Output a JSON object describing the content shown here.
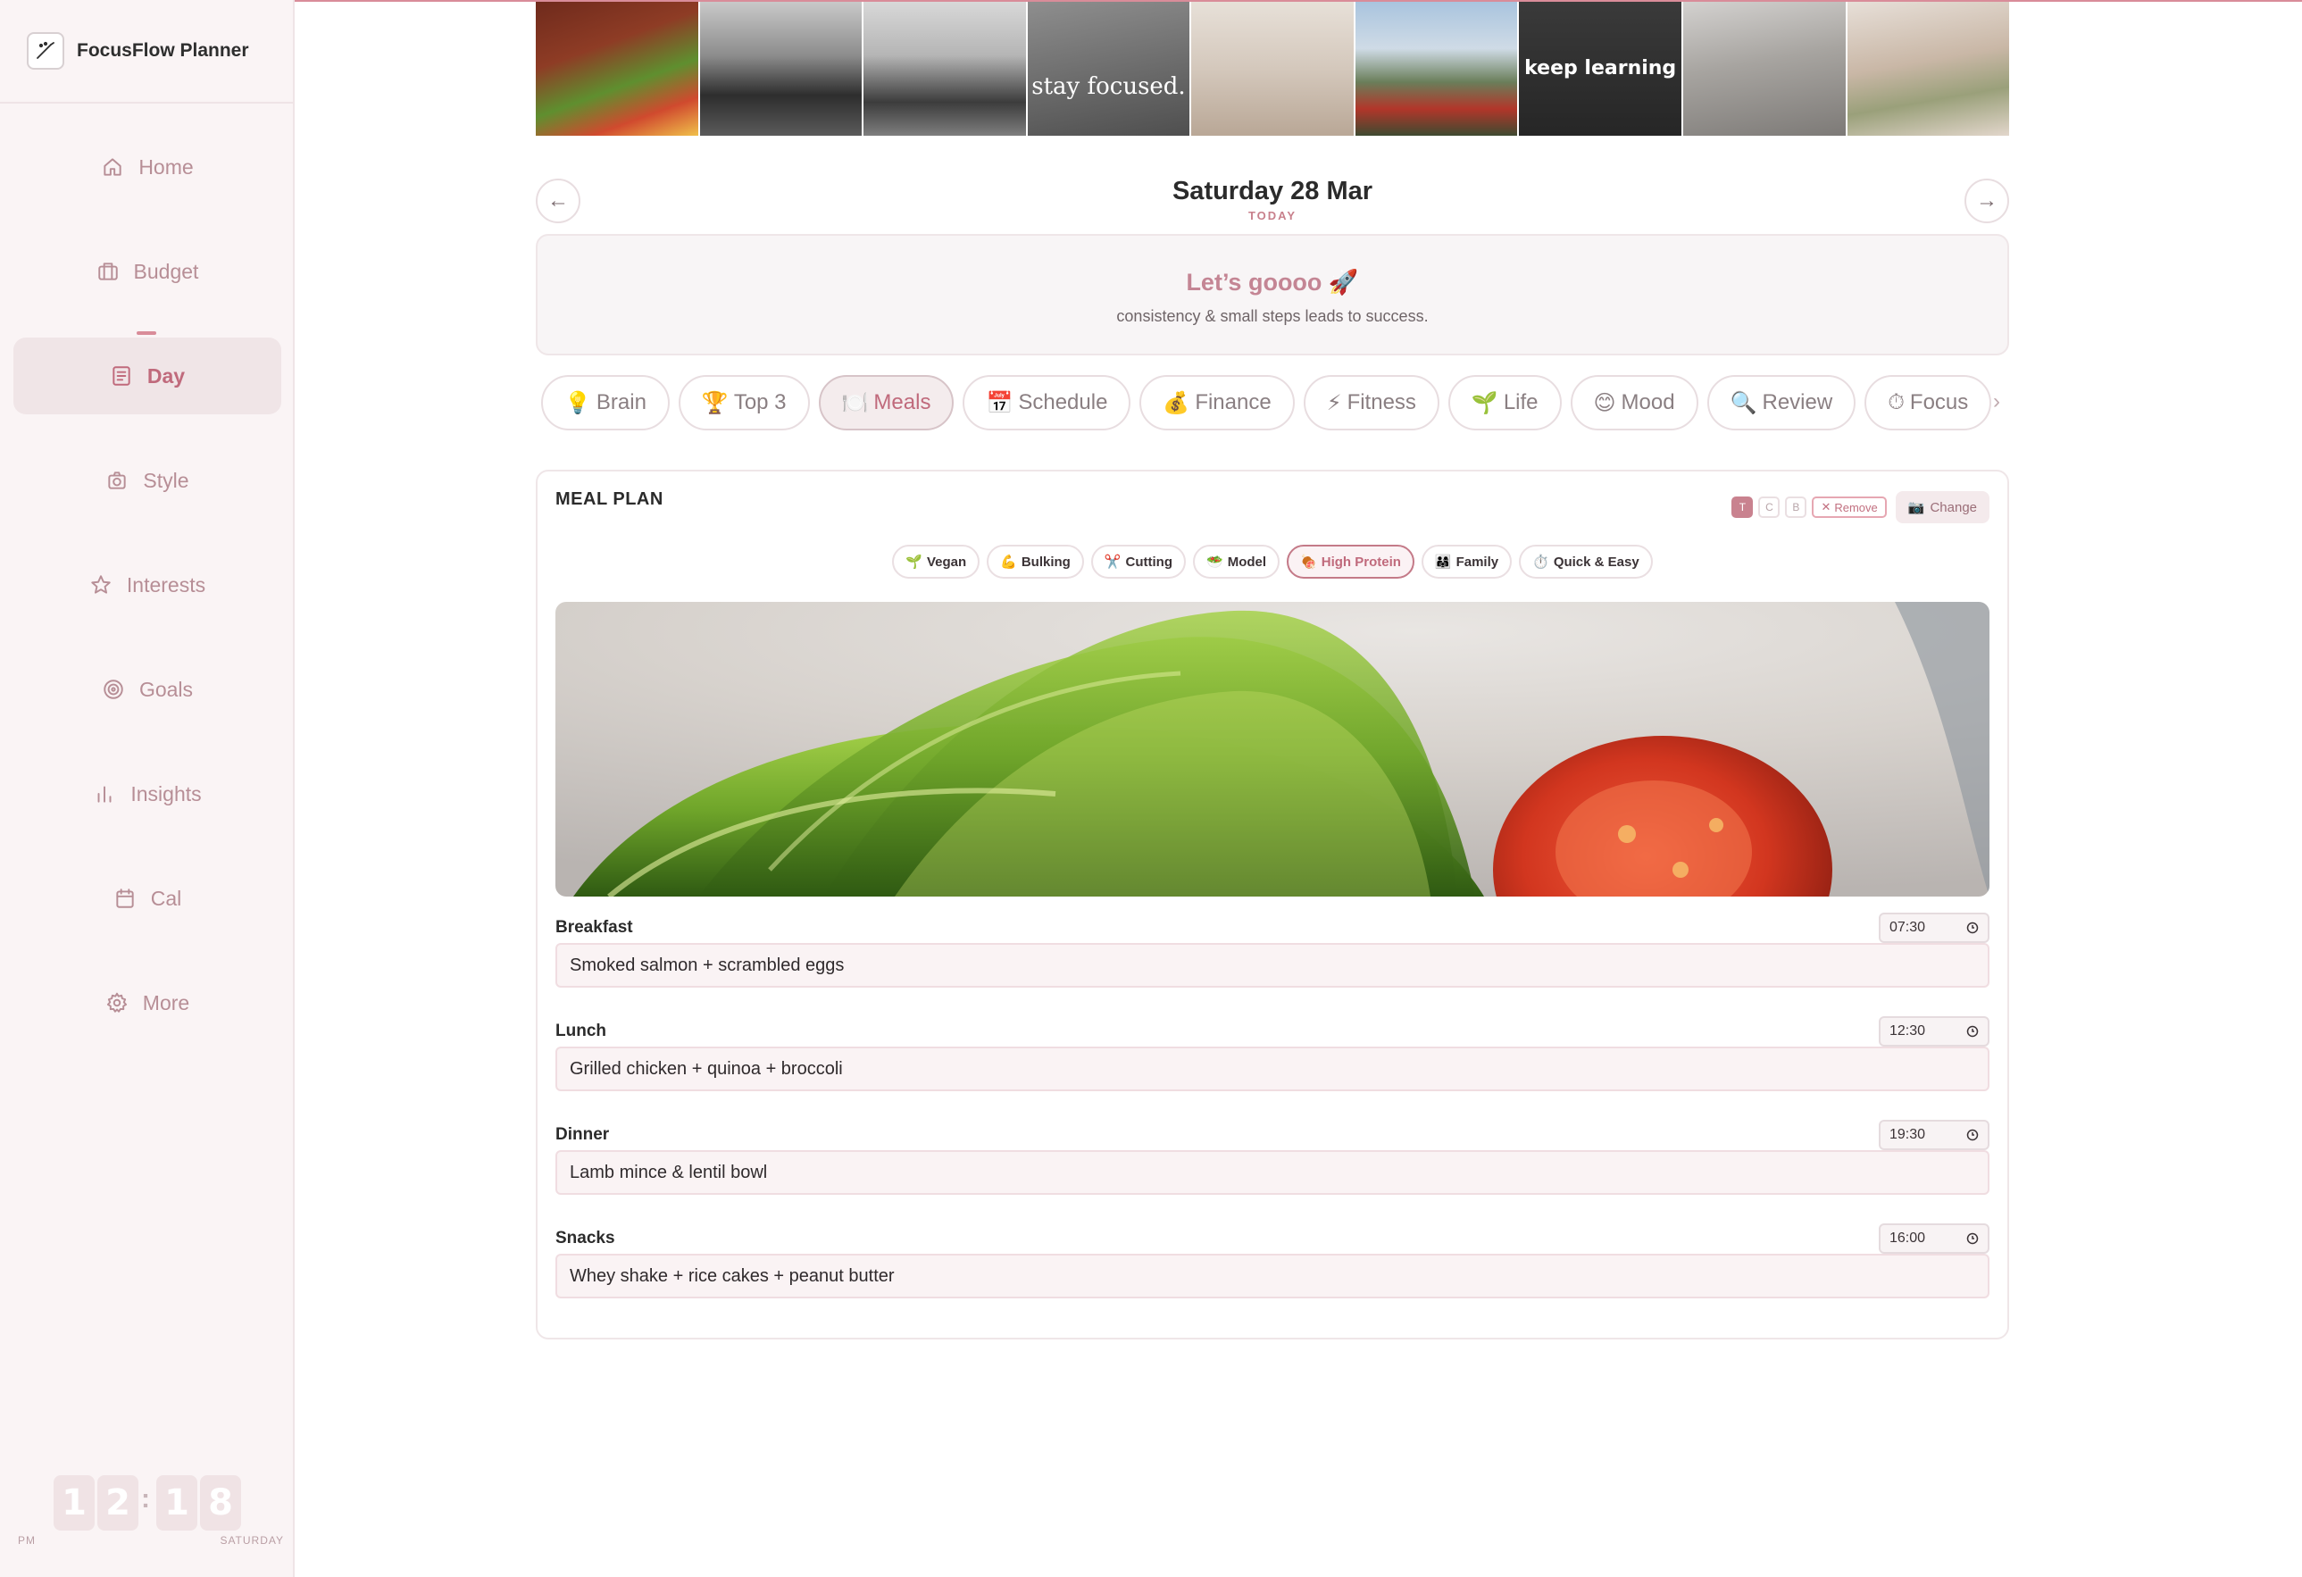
{
  "app": {
    "name": "FocusFlow Planner"
  },
  "nav": {
    "items": [
      {
        "label": "Home",
        "icon": "home-icon"
      },
      {
        "label": "Budget",
        "icon": "briefcase-icon"
      },
      {
        "label": "Day",
        "icon": "day-page-icon",
        "active": true
      },
      {
        "label": "Style",
        "icon": "camera-icon"
      },
      {
        "label": "Interests",
        "icon": "star-icon"
      },
      {
        "label": "Goals",
        "icon": "target-icon"
      },
      {
        "label": "Insights",
        "icon": "bar-chart-icon"
      },
      {
        "label": "Cal",
        "icon": "calendar-icon"
      },
      {
        "label": "More",
        "icon": "gear-icon"
      }
    ]
  },
  "clock": {
    "h1": "1",
    "h2": "2",
    "m1": "1",
    "m2": "8",
    "ampm": "PM",
    "day": "SATURDAY"
  },
  "mood_board": {
    "tiles": [
      {
        "name": "steak-eggs-avocado-photo",
        "text": ""
      },
      {
        "name": "gym-workout-photo",
        "text": ""
      },
      {
        "name": "gym-mirror-photo",
        "text": ""
      },
      {
        "name": "stay-focused-photo",
        "text": "stay focused."
      },
      {
        "name": "reading-book-photo",
        "text": ""
      },
      {
        "name": "mount-fuji-photo",
        "text": ""
      },
      {
        "name": "keep-learning-photo",
        "text": "keep learning"
      },
      {
        "name": "laptop-coffee-photo",
        "text": ""
      },
      {
        "name": "face-mask-selfcare-photo",
        "text": ""
      }
    ]
  },
  "day_header": {
    "title": "Saturday 28 Mar",
    "subtitle": "TODAY",
    "prev": "←",
    "next": "→"
  },
  "motto": {
    "title": "Let’s goooo 🚀",
    "subtitle": "consistency & small steps leads to success."
  },
  "tabs": [
    {
      "icon": "💡",
      "label": "Brain"
    },
    {
      "icon": "🏆",
      "label": "Top 3"
    },
    {
      "icon": "🍽️",
      "label": "Meals",
      "active": true
    },
    {
      "icon": "📅",
      "label": "Schedule"
    },
    {
      "icon": "💰",
      "label": "Finance"
    },
    {
      "icon": "⚡",
      "label": "Fitness"
    },
    {
      "icon": "🌱",
      "label": "Life"
    },
    {
      "icon": "😊",
      "label": "Mood"
    },
    {
      "icon": "🔍",
      "label": "Review"
    },
    {
      "icon": "⏱",
      "label": "Focus"
    }
  ],
  "tabs_more": "›",
  "meal_plan": {
    "title": "MEAL PLAN",
    "tools": {
      "t": "T",
      "c": "C",
      "b": "B",
      "remove": "Remove",
      "remove_icon": "✕",
      "change": "Change",
      "change_icon": "📷"
    },
    "filters": [
      {
        "icon": "🌱",
        "label": "Vegan"
      },
      {
        "icon": "💪",
        "label": "Bulking"
      },
      {
        "icon": "✂️",
        "label": "Cutting"
      },
      {
        "icon": "🥗",
        "label": "Model"
      },
      {
        "icon": "🍖",
        "label": "High Protein",
        "active": true
      },
      {
        "icon": "👨‍👩‍👧",
        "label": "Family"
      },
      {
        "icon": "⏱️",
        "label": "Quick & Easy"
      }
    ],
    "meals": [
      {
        "label": "Breakfast",
        "time": "07:30",
        "value": "Smoked salmon + scrambled eggs"
      },
      {
        "label": "Lunch",
        "time": "12:30",
        "value": "Grilled chicken + quinoa + broccoli"
      },
      {
        "label": "Dinner",
        "time": "19:30",
        "value": "Lamb mince & lentil bowl"
      },
      {
        "label": "Snacks",
        "time": "16:00",
        "value": "Whey shake + rice cakes + peanut butter"
      }
    ]
  },
  "colors": {
    "accent": "#c06a7c",
    "sidebar_bg": "#faf4f5",
    "border": "#efe6e8"
  }
}
